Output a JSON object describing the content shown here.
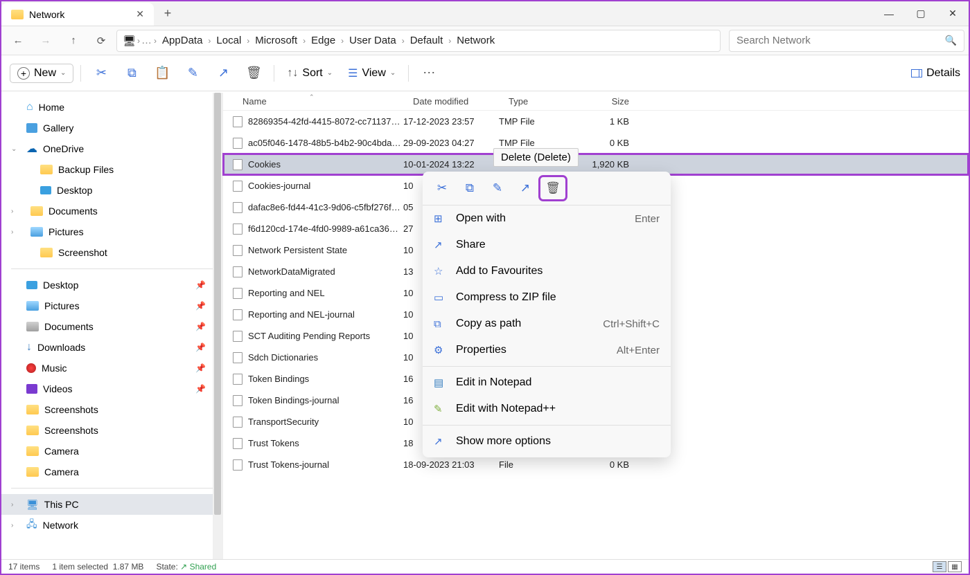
{
  "tab": {
    "title": "Network"
  },
  "breadcrumbs": [
    "AppData",
    "Local",
    "Microsoft",
    "Edge",
    "User Data",
    "Default",
    "Network"
  ],
  "search": {
    "placeholder": "Search Network"
  },
  "toolbar": {
    "new": "New",
    "sort": "Sort",
    "view": "View",
    "details": "Details"
  },
  "sidebar": {
    "home": "Home",
    "gallery": "Gallery",
    "onedrive": "OneDrive",
    "backup": "Backup Files",
    "desktop": "Desktop",
    "documents": "Documents",
    "pictures": "Pictures",
    "screenshot": "Screenshot",
    "desktop2": "Desktop",
    "pictures2": "Pictures",
    "documents2": "Documents",
    "downloads": "Downloads",
    "music": "Music",
    "videos": "Videos",
    "screenshots": "Screenshots",
    "screenshots2": "Screenshots",
    "camera": "Camera",
    "camera2": "Camera",
    "thispc": "This PC",
    "network": "Network"
  },
  "columns": {
    "name": "Name",
    "date": "Date modified",
    "type": "Type",
    "size": "Size"
  },
  "files": [
    {
      "name": "82869354-42fd-4415-8072-cc71137bca6f...",
      "date": "17-12-2023 23:57",
      "type": "TMP File",
      "size": "1 KB"
    },
    {
      "name": "ac05f046-1478-48b5-b4b2-90c4bdaa186...",
      "date": "29-09-2023 04:27",
      "type": "TMP File",
      "size": "0 KB"
    },
    {
      "name": "Cookies",
      "date": "10-01-2024 13:22",
      "type": "",
      "size": "1,920 KB"
    },
    {
      "name": "Cookies-journal",
      "date": "10",
      "type": "",
      "size": ""
    },
    {
      "name": "dafac8e6-fd44-41c3-9d06-c5fbf276f4d7.t...",
      "date": "05",
      "type": "",
      "size": ""
    },
    {
      "name": "f6d120cd-174e-4fd0-9989-a61ca367cce1...",
      "date": "27",
      "type": "",
      "size": ""
    },
    {
      "name": "Network Persistent State",
      "date": "10",
      "type": "",
      "size": ""
    },
    {
      "name": "NetworkDataMigrated",
      "date": "13",
      "type": "",
      "size": ""
    },
    {
      "name": "Reporting and NEL",
      "date": "10",
      "type": "",
      "size": ""
    },
    {
      "name": "Reporting and NEL-journal",
      "date": "10",
      "type": "",
      "size": ""
    },
    {
      "name": "SCT Auditing Pending Reports",
      "date": "10",
      "type": "",
      "size": ""
    },
    {
      "name": "Sdch Dictionaries",
      "date": "10",
      "type": "",
      "size": ""
    },
    {
      "name": "Token Bindings",
      "date": "16",
      "type": "",
      "size": ""
    },
    {
      "name": "Token Bindings-journal",
      "date": "16",
      "type": "",
      "size": ""
    },
    {
      "name": "TransportSecurity",
      "date": "10",
      "type": "",
      "size": ""
    },
    {
      "name": "Trust Tokens",
      "date": "18",
      "type": "",
      "size": ""
    },
    {
      "name": "Trust Tokens-journal",
      "date": "18-09-2023 21:03",
      "type": "File",
      "size": "0 KB"
    }
  ],
  "contextMenu": {
    "openWith": "Open with",
    "openWithKey": "Enter",
    "share": "Share",
    "fav": "Add to Favourites",
    "zip": "Compress to ZIP file",
    "copyPath": "Copy as path",
    "copyPathKey": "Ctrl+Shift+C",
    "props": "Properties",
    "propsKey": "Alt+Enter",
    "notepad": "Edit in Notepad",
    "notepadpp": "Edit with Notepad++",
    "more": "Show more options"
  },
  "tooltip": "Delete (Delete)",
  "status": {
    "items": "17 items",
    "selected": "1 item selected",
    "size": "1.87 MB",
    "stateLabel": "State:",
    "stateVal": "Shared"
  }
}
